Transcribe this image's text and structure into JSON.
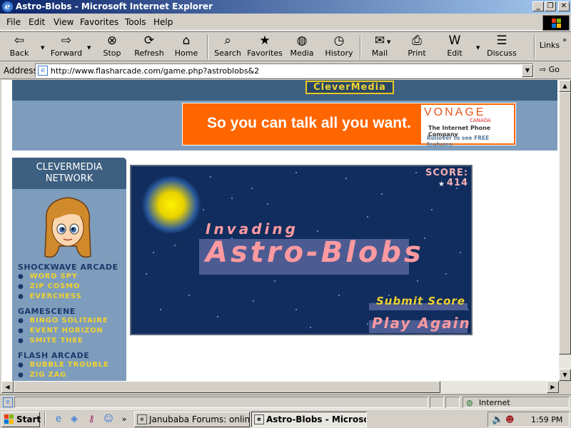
{
  "window": {
    "title": "Astro-Blobs - Microsoft Internet Explorer"
  },
  "menu": [
    "File",
    "Edit",
    "View",
    "Favorites",
    "Tools",
    "Help"
  ],
  "toolbar": {
    "back": "Back",
    "forward": "Forward",
    "stop": "Stop",
    "refresh": "Refresh",
    "home": "Home",
    "search": "Search",
    "favorites": "Favorites",
    "media": "Media",
    "history": "History",
    "mail": "Mail",
    "print": "Print",
    "edit": "Edit",
    "discuss": "Discuss",
    "links": "Links"
  },
  "address": {
    "label": "Address",
    "url": "http://www.flasharcade.com/game.php?astroblobs&2",
    "go": "Go"
  },
  "page": {
    "logo": "CleverMedia",
    "ad": {
      "message": "So you can talk all you want.",
      "brand": "VONAGE",
      "country": "CANADA",
      "tagline": "The Internet Phone Company",
      "rollover": "Rollover to see FREE features"
    },
    "sidebar": {
      "heading_line1": "CLEVERMEDIA",
      "heading_line2": "NETWORK",
      "sections": [
        {
          "title": "SHOCKWAVE ARCADE",
          "items": [
            "WORD SPY",
            "ZIP COSMO",
            "EVERCHESS"
          ]
        },
        {
          "title": "GAMESCENE",
          "items": [
            "BINGO SOLITAIRE",
            "EVENT HORIZON",
            "SMITE THEE"
          ]
        },
        {
          "title": "FLASH ARCADE",
          "items": [
            "BUBBLE TROUBLE",
            "ZIG ZAG"
          ]
        }
      ]
    },
    "game": {
      "score_label": "SCORE:",
      "score_value": "414",
      "subtitle": "Invading",
      "title": "Astro-Blobs",
      "submit": "Submit Score",
      "play_again": "Play Again"
    }
  },
  "status": {
    "zone": "Internet"
  },
  "taskbar": {
    "start": "Start",
    "tasks": [
      "Janubaba Forums: online ...",
      "Astro-Blobs - Microsof..."
    ],
    "clock": "1:59 PM"
  },
  "colors": {
    "game_bg": "#102d5e",
    "page_band": "#3d5f80",
    "sidebar": "#7e9dbc",
    "ad_orange": "#ff6600",
    "title_pink": "#ff9aa0",
    "menu_yellow": "#f0d230"
  }
}
